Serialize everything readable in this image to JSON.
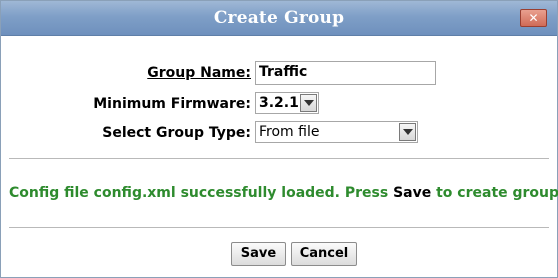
{
  "dialog": {
    "title": "Create Group",
    "close_symbol": "✕"
  },
  "form": {
    "group_name_label": "Group Name:",
    "group_name_value": "Traffic",
    "min_firmware_label": "Minimum Firmware:",
    "min_firmware_value": "3.2.1",
    "group_type_label": "Select Group Type:",
    "group_type_value": "From file"
  },
  "message": {
    "before": "Config file config.xml successfully loaded. Press ",
    "emphasis": "Save",
    "after": " to create group."
  },
  "buttons": {
    "save": "Save",
    "cancel": "Cancel"
  },
  "colors": {
    "title_bar": "#7f9fc7",
    "success_text": "#2e8b2e",
    "close_button": "#d06b57"
  }
}
